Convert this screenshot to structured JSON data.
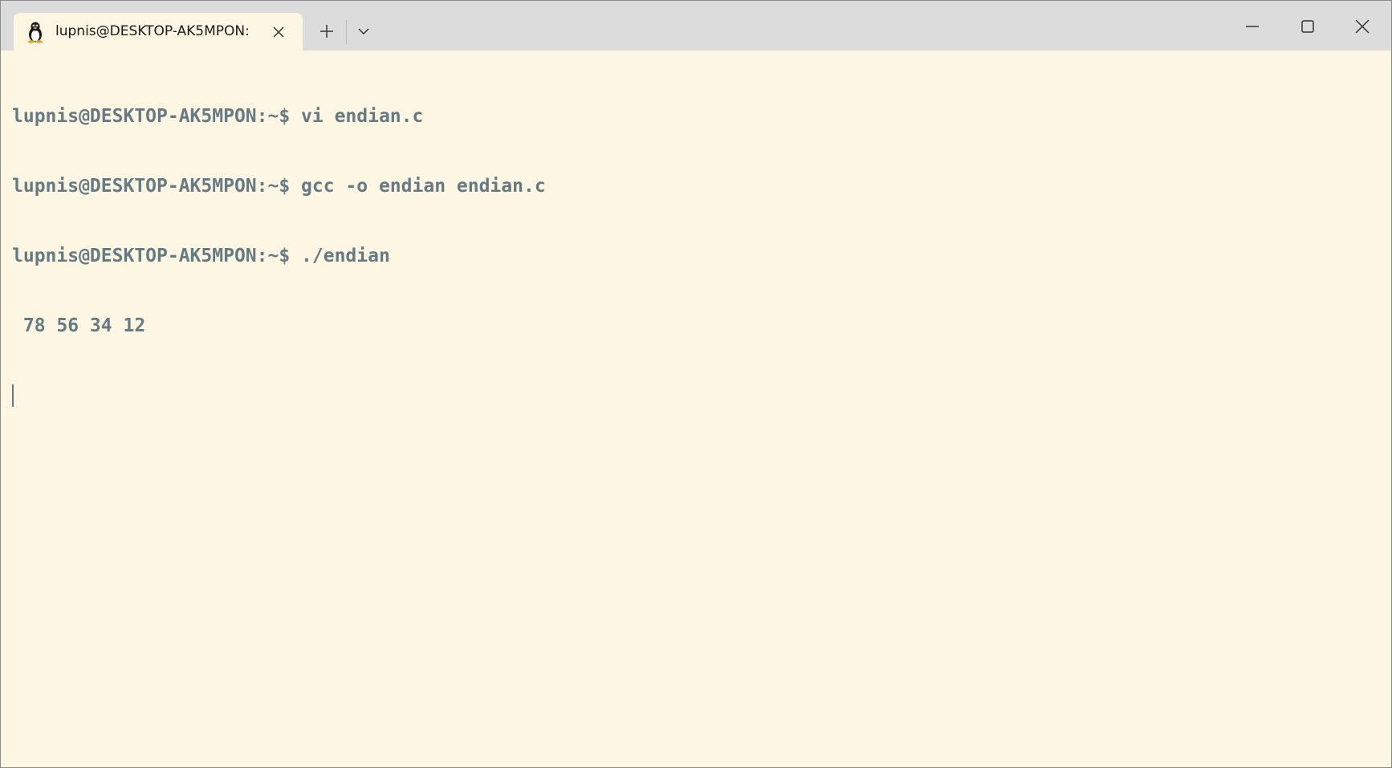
{
  "window": {
    "tab_title": "lupnis@DESKTOP-AK5MPON:",
    "tab_icon": "linux-penguin-icon"
  },
  "terminal": {
    "lines": [
      "lupnis@DESKTOP-AK5MPON:~$ vi endian.c",
      "lupnis@DESKTOP-AK5MPON:~$ gcc -o endian endian.c",
      "lupnis@DESKTOP-AK5MPON:~$ ./endian",
      " 78 56 34 12"
    ]
  },
  "colors": {
    "terminal_bg": "#fdf6e3",
    "terminal_fg": "#657b83",
    "titlebar_bg": "#dcdcdc"
  }
}
